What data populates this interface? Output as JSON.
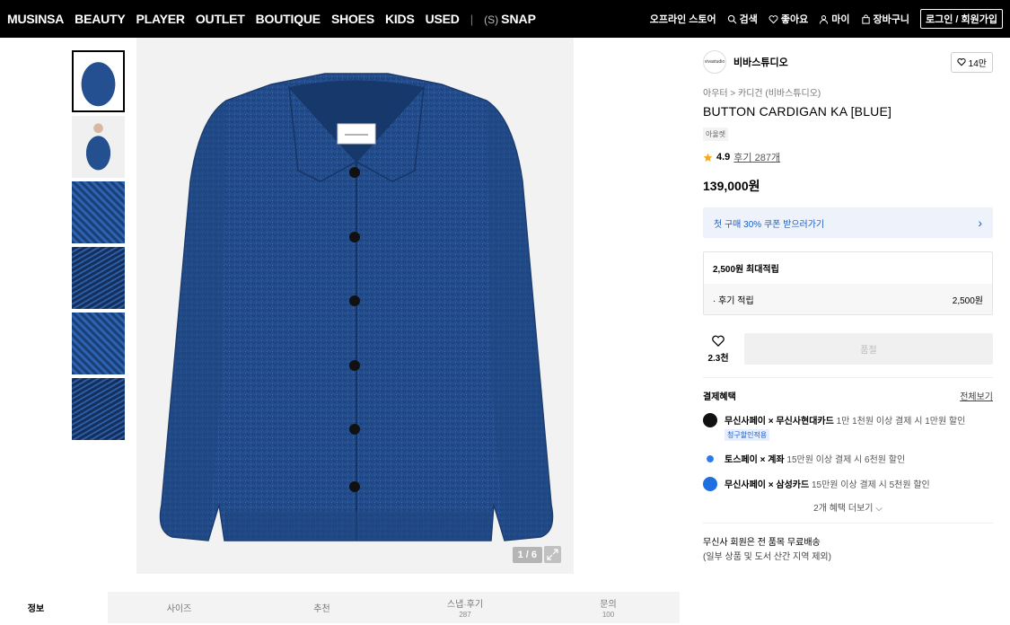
{
  "nav": {
    "left": [
      "MUSINSA",
      "BEAUTY",
      "PLAYER",
      "OUTLET",
      "BOUTIQUE",
      "SHOES",
      "KIDS",
      "USED"
    ],
    "snap_prefix": "(S)",
    "snap_label": "SNAP",
    "offline_store": "오프라인 스토어",
    "search": "검색",
    "likes": "좋아요",
    "my": "마이",
    "cart": "장바구니",
    "login": "로그인 / 회원가입"
  },
  "gallery": {
    "pager": "1 / 6",
    "thumbnail_count": 6
  },
  "brand": {
    "logo_text": "vivastudio",
    "name": "비바스튜디오",
    "likes": "14만"
  },
  "product": {
    "breadcrumb": "아우터 > 카디건 (비바스튜디오)",
    "title": "BUTTON CARDIGAN KA [BLUE]",
    "tag": "아울렛",
    "rating": "4.9",
    "reviews": "후기 287개",
    "price": "139,000원"
  },
  "coupon": {
    "label": "첫 구매 30% 쿠폰 받으러가기",
    "arrow": "›"
  },
  "points": {
    "max_label": "2,500원 최대적립",
    "review_label": "· 후기 적립",
    "review_value": "2,500원"
  },
  "buy": {
    "wish_count": "2.3천",
    "soldout": "품절"
  },
  "payment": {
    "title": "결제혜택",
    "view_all": "전체보기",
    "benefits": [
      {
        "name": "무신사페이 × 무신사현대카드",
        "desc": " 1만 1천원 이상 결제 시 1만원 할인",
        "chip": "청구할인적용"
      },
      {
        "name": "토스페이 × 계좌",
        "desc": " 15만원 이상 결제 시 6천원 할인",
        "chip": ""
      },
      {
        "name": "무신사페이 × 삼성카드",
        "desc": " 15만원 이상 결제 시 5천원 할인",
        "chip": ""
      }
    ],
    "more": "2개 혜택 더보기 ⌵"
  },
  "shipping": {
    "line1": "무신사 회원은 전 품목 무료배송",
    "line2": "(일부 상품 및 도서 산간 지역 제외)"
  },
  "tabs": [
    {
      "label": "정보",
      "count": ""
    },
    {
      "label": "사이즈",
      "count": ""
    },
    {
      "label": "추천",
      "count": ""
    },
    {
      "label": "스냅·후기",
      "count": "287"
    },
    {
      "label": "문의",
      "count": "100"
    }
  ],
  "colors": {
    "topbar": "#000000",
    "accent_blue": "#1a5ec8",
    "cardigan_blue": "#234f90"
  }
}
